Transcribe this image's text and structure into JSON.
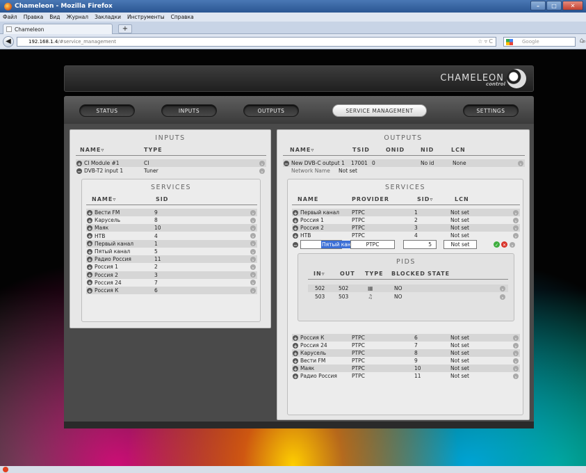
{
  "window": {
    "title": "Chameleon - Mozilla Firefox",
    "controls": [
      "–",
      "□",
      "✕"
    ]
  },
  "menu": [
    "Файл",
    "Правка",
    "Вид",
    "Журнал",
    "Закладки",
    "Инструменты",
    "Справка"
  ],
  "tab": {
    "title": "Chameleon",
    "new_tab": "+"
  },
  "address": {
    "host": "192.168.1.4",
    "path": "/#service_management",
    "right_icons": "☆ ▿ C"
  },
  "search": {
    "placeholder": "Google"
  },
  "logo": {
    "word": "CHAMELEON",
    "sub": "control"
  },
  "nav": {
    "status": "STATUS",
    "inputs": "INPUTS",
    "outputs": "OUTPUTS",
    "service_management": "SERVICE MANAGEMENT",
    "settings": "SETTINGS"
  },
  "inputs_panel": {
    "title": "INPUTS",
    "col_name": "NAME▿",
    "col_type": "TYPE",
    "rows": [
      {
        "name": "CI Module #1",
        "type": "CI"
      },
      {
        "name": "DVB-T2 input 1",
        "type": "Tuner"
      }
    ],
    "services": {
      "title": "SERVICES",
      "col_name": "NAME▿",
      "col_sid": "SID",
      "rows": [
        {
          "name": "Вести FM",
          "sid": "9"
        },
        {
          "name": "Карусель",
          "sid": "8"
        },
        {
          "name": "Маяк",
          "sid": "10"
        },
        {
          "name": "НТВ",
          "sid": "4"
        },
        {
          "name": "Первый канал",
          "sid": "1"
        },
        {
          "name": "Пятый канал",
          "sid": "5"
        },
        {
          "name": "Радио Россия",
          "sid": "11"
        },
        {
          "name": "Россия 1",
          "sid": "2"
        },
        {
          "name": "Россия 2",
          "sid": "3"
        },
        {
          "name": "Россия 24",
          "sid": "7"
        },
        {
          "name": "Россия К",
          "sid": "6"
        }
      ]
    }
  },
  "outputs_panel": {
    "title": "OUTPUTS",
    "col_name": "NAME▿",
    "col_tsid": "TSID",
    "col_onid": "ONID",
    "col_nid": "NID",
    "col_lcn": "LCN",
    "output": {
      "name": "New DVB-C output 1",
      "tsid": "17001",
      "onid": "0",
      "nid": "No id",
      "lcn": "None"
    },
    "network_label": "Network Name",
    "network_value": "Not set",
    "services": {
      "title": "SERVICES",
      "col_name": "NAME",
      "col_provider": "PROVIDER",
      "col_sid": "SID▿",
      "col_lcn": "LCN",
      "rows_top": [
        {
          "name": "Первый канал",
          "provider": "PTPC",
          "sid": "1",
          "lcn": "Not set"
        },
        {
          "name": "Россия 1",
          "provider": "PTPC",
          "sid": "2",
          "lcn": "Not set"
        },
        {
          "name": "Россия 2",
          "provider": "PTPC",
          "sid": "3",
          "lcn": "Not set"
        },
        {
          "name": "НТВ",
          "provider": "PTPC",
          "sid": "4",
          "lcn": "Not set"
        }
      ],
      "editing": {
        "name": "Пятый канал",
        "provider": "PTPC",
        "sid": "5",
        "lcn": "Not set"
      },
      "rows_bottom": [
        {
          "name": "Россия К",
          "provider": "PTPC",
          "sid": "6",
          "lcn": "Not set"
        },
        {
          "name": "Россия 24",
          "provider": "PTPC",
          "sid": "7",
          "lcn": "Not set"
        },
        {
          "name": "Карусель",
          "provider": "PTPC",
          "sid": "8",
          "lcn": "Not set"
        },
        {
          "name": "Вести FM",
          "provider": "PTPC",
          "sid": "9",
          "lcn": "Not set"
        },
        {
          "name": "Маяк",
          "provider": "PTPC",
          "sid": "10",
          "lcn": "Not set"
        },
        {
          "name": "Радио Россия",
          "provider": "PTPC",
          "sid": "11",
          "lcn": "Not set"
        }
      ]
    },
    "pids": {
      "title": "PIDS",
      "col_in": "IN▿",
      "col_out": "OUT",
      "col_type": "TYPE",
      "col_blocked": "BLOCKED",
      "col_state": "STATE",
      "rows": [
        {
          "in": "502",
          "out": "502",
          "type_icon": "video-icon",
          "blocked": "NO"
        },
        {
          "in": "503",
          "out": "503",
          "type_icon": "audio-icon",
          "blocked": "NO"
        }
      ]
    }
  },
  "colors": {
    "accent_green": "#3fae3f",
    "accent_red": "#d9342b",
    "selection_blue": "#3b6fd6"
  }
}
